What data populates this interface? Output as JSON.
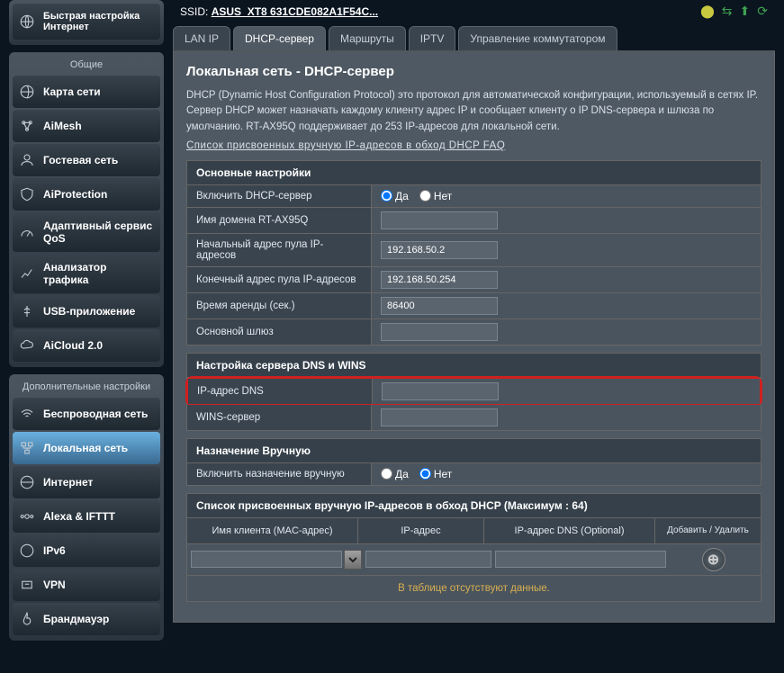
{
  "header": {
    "ssid_label": "SSID:",
    "ssid_value": "ASUS_XT8  631CDE082A1F54C..."
  },
  "sidebar": {
    "quick": {
      "label": "Быстрая настройка Интернет"
    },
    "general_title": "Общие",
    "general_items": [
      {
        "label": "Карта сети"
      },
      {
        "label": "AiMesh"
      },
      {
        "label": "Гостевая сеть"
      },
      {
        "label": "AiProtection"
      },
      {
        "label": "Адаптивный сервис QoS"
      },
      {
        "label": "Анализатор трафика"
      },
      {
        "label": "USB-приложение"
      },
      {
        "label": "AiCloud 2.0"
      }
    ],
    "advanced_title": "Дополнительные настройки",
    "advanced_items": [
      {
        "label": "Беспроводная сеть"
      },
      {
        "label": "Локальная сеть"
      },
      {
        "label": "Интернет"
      },
      {
        "label": "Alexa & IFTTT"
      },
      {
        "label": "IPv6"
      },
      {
        "label": "VPN"
      },
      {
        "label": "Брандмауэр"
      }
    ]
  },
  "tabs": [
    {
      "label": "LAN IP"
    },
    {
      "label": "DHCP-сервер"
    },
    {
      "label": "Маршруты"
    },
    {
      "label": "IPTV"
    },
    {
      "label": "Управление коммутатором"
    }
  ],
  "page": {
    "title": "Локальная сеть - DHCP-сервер",
    "desc": "DHCP (Dynamic Host Configuration Protocol) это протокол для автоматической конфигурации, используемый в сетях IP. Сервер DHCP может назначать каждому клиенту адрес IP и сообщает клиенту о IP DNS-сервера и шлюза по умолчанию. RT-AX95Q поддерживает до 253 IP-адресов для локальной сети.",
    "faq_link": "Список присвоенных вручную IP-адресов в обход DHCP FAQ"
  },
  "basic": {
    "header": "Основные настройки",
    "enable_label": "Включить DHCP-сервер",
    "yes": "Да",
    "no": "Нет",
    "domain_label": "Имя домена RT-AX95Q",
    "domain_value": "",
    "start_label": "Начальный адрес пула IP-адресов",
    "start_value": "192.168.50.2",
    "end_label": "Конечный адрес пула IP-адресов",
    "end_value": "192.168.50.254",
    "lease_label": "Время аренды (сек.)",
    "lease_value": "86400",
    "gw_label": "Основной шлюз",
    "gw_value": ""
  },
  "dns": {
    "header": "Настройка сервера DNS и WINS",
    "dns_label": "IP-адрес DNS",
    "dns_value": "",
    "wins_label": "WINS-сервер",
    "wins_value": ""
  },
  "manual": {
    "header": "Назначение Вручную",
    "enable_label": "Включить назначение вручную",
    "yes": "Да",
    "no": "Нет"
  },
  "table": {
    "header": "Список присвоенных вручную IP-адресов в обход DHCP (Максимум : 64)",
    "col_mac": "Имя клиента (MAC-адрес)",
    "col_ip": "IP-адрес",
    "col_dns": "IP-адрес DNS (Optional)",
    "col_act": "Добавить / Удалить",
    "mac_placeholder": "",
    "empty_msg": "В таблице отсутствуют данные."
  }
}
